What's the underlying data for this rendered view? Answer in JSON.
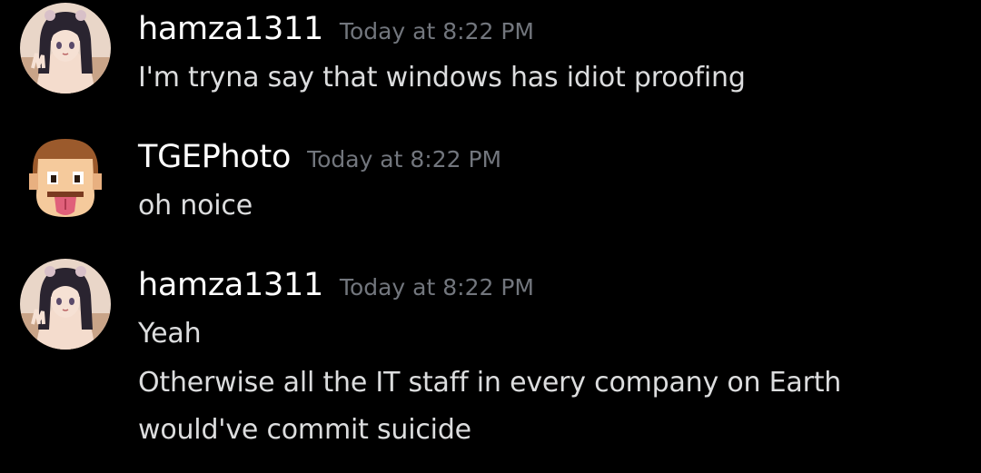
{
  "messages": [
    {
      "author": "hamza1311",
      "timestamp": "Today at 8:22 PM",
      "avatar": "anime-girl-avatar",
      "lines": [
        "I'm tryna say that windows has idiot proofing"
      ]
    },
    {
      "author": "TGEPhoto",
      "timestamp": "Today at 8:22 PM",
      "avatar": "pixel-face-tongue-avatar",
      "lines": [
        "oh noice"
      ]
    },
    {
      "author": "hamza1311",
      "timestamp": "Today at 8:22 PM",
      "avatar": "anime-girl-avatar",
      "lines": [
        "Yeah",
        "Otherwise all the IT staff in every company on Earth",
        "would've commit suicide"
      ]
    }
  ],
  "colors": {
    "background": "#000000",
    "username": "#ffffff",
    "timestamp": "#72767d",
    "message_text": "#dcddde"
  }
}
